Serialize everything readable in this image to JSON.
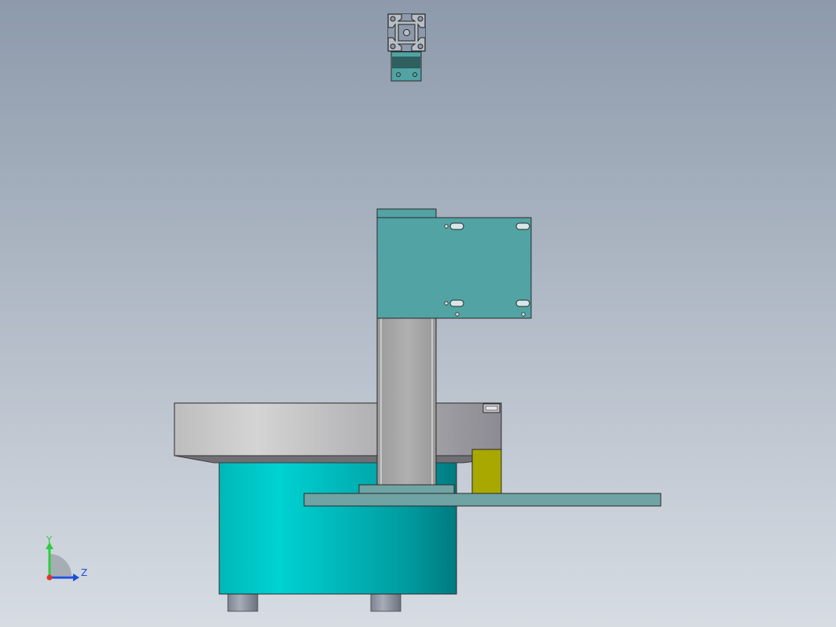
{
  "viewport": {
    "background_top": "#8d9aab",
    "background_bottom": "#d7dce3"
  },
  "triad": {
    "labels": {
      "y": "Y",
      "z": "Z"
    },
    "colors": {
      "y": "#2ecc40",
      "z": "#1f4fd8",
      "origin": "#e0322b"
    }
  },
  "colors": {
    "teal_plate": "#52a3a3",
    "teal_cylinder_light": "#00cfcf",
    "teal_cylinder_dark": "#007a80",
    "base_plate": "#70a3a3",
    "column": "#a6a6a6",
    "bowl_light": "#d2d2d2",
    "bowl_dark": "#8f8f96",
    "yellow_block": "#a8a800",
    "dark_slot": "#2f5f5f",
    "edge": "#2a2a2a"
  }
}
